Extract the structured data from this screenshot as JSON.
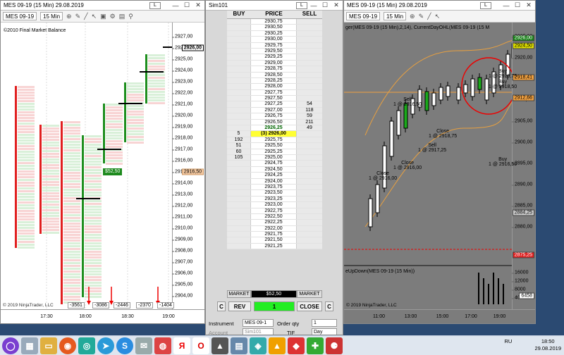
{
  "left_window": {
    "title": "MES 09-19 (15 Min) 29.08.2019",
    "title_button": "L",
    "instrument": "MES 09-19",
    "interval": "15 Min",
    "watermark": "©2010 Final Market Balance",
    "footer_copyright": "© 2019 NinjaTrader, LLC",
    "price_labels": [
      "2927,00",
      "2926,00",
      "2925,00",
      "2924,00",
      "2923,00",
      "2922,00",
      "2921,00",
      "2920,00",
      "2919,00",
      "2918,00",
      "2917,00",
      "2916,00",
      "2915,00",
      "2914,00",
      "2913,00",
      "2912,00",
      "2911,00",
      "2910,00",
      "2909,00",
      "2908,00",
      "2907,00",
      "2906,00",
      "2905,00",
      "2904,00"
    ],
    "current_price": "2926,00",
    "side_price": "2916,50",
    "pl_badge": "$52,50",
    "time_labels": [
      "17:30",
      "18:00",
      "18:30",
      "19:00"
    ],
    "delta_values": [
      "-3561",
      "-3086",
      "-2446",
      "-2370",
      "-1404"
    ],
    "colors": {
      "up": "#1e8f1e",
      "down": "#e11f1f",
      "current": "#14a814"
    }
  },
  "dom_window": {
    "title": "Sim101",
    "headers": {
      "buy": "BUY",
      "price": "PRICE",
      "sell": "SELL"
    },
    "rows": [
      {
        "buy": "",
        "price": "2930,75",
        "sell": ""
      },
      {
        "buy": "",
        "price": "2930,50",
        "sell": ""
      },
      {
        "buy": "",
        "price": "2930,25",
        "sell": ""
      },
      {
        "buy": "",
        "price": "2930,00",
        "sell": ""
      },
      {
        "buy": "",
        "price": "2929,75",
        "sell": ""
      },
      {
        "buy": "",
        "price": "2929,50",
        "sell": ""
      },
      {
        "buy": "",
        "price": "2929,25",
        "sell": ""
      },
      {
        "buy": "",
        "price": "2929,00",
        "sell": ""
      },
      {
        "buy": "",
        "price": "2928,75",
        "sell": ""
      },
      {
        "buy": "",
        "price": "2928,50",
        "sell": ""
      },
      {
        "buy": "",
        "price": "2928,25",
        "sell": ""
      },
      {
        "buy": "",
        "price": "2928,00",
        "sell": ""
      },
      {
        "buy": "",
        "price": "2927,75",
        "sell": ""
      },
      {
        "buy": "",
        "price": "2927,50",
        "sell": ""
      },
      {
        "buy": "",
        "price": "2927,25",
        "sell": "54"
      },
      {
        "buy": "",
        "price": "2927,00",
        "sell": "118"
      },
      {
        "buy": "",
        "price": "2926,75",
        "sell": "59"
      },
      {
        "buy": "",
        "price": "2926,50",
        "sell": "211"
      },
      {
        "buy": "",
        "price": "2926,25",
        "sell": "49",
        "style": "hl"
      },
      {
        "buy": "5",
        "price": "(3) 2926,00",
        "sell": "",
        "style": "cur"
      },
      {
        "buy": "192",
        "price": "2925,75",
        "sell": ""
      },
      {
        "buy": "51",
        "price": "2925,50",
        "sell": ""
      },
      {
        "buy": "60",
        "price": "2925,25",
        "sell": ""
      },
      {
        "buy": "105",
        "price": "2925,00",
        "sell": ""
      },
      {
        "buy": "",
        "price": "2924,75",
        "sell": ""
      },
      {
        "buy": "",
        "price": "2924,50",
        "sell": ""
      },
      {
        "buy": "",
        "price": "2924,25",
        "sell": ""
      },
      {
        "buy": "",
        "price": "2924,00",
        "sell": ""
      },
      {
        "buy": "",
        "price": "2923,75",
        "sell": ""
      },
      {
        "buy": "",
        "price": "2923,50",
        "sell": ""
      },
      {
        "buy": "",
        "price": "2923,25",
        "sell": ""
      },
      {
        "buy": "",
        "price": "2923,00",
        "sell": ""
      },
      {
        "buy": "",
        "price": "2922,75",
        "sell": ""
      },
      {
        "buy": "",
        "price": "2922,50",
        "sell": ""
      },
      {
        "buy": "",
        "price": "2922,25",
        "sell": ""
      },
      {
        "buy": "",
        "price": "2922,00",
        "sell": ""
      },
      {
        "buy": "",
        "price": "2921,75",
        "sell": ""
      },
      {
        "buy": "",
        "price": "2921,50",
        "sell": ""
      },
      {
        "buy": "",
        "price": "2921,25",
        "sell": ""
      }
    ],
    "market_buy": "MARKET",
    "market_sell": "MARKET",
    "pnl": "$52,50",
    "rev": "REV",
    "qty_display": "1",
    "close": "CLOSE",
    "c_left": "C",
    "c_right": "C",
    "instrument_label": "Instrument",
    "instrument_value": "MES 09-1",
    "order_qty_label": "Order qty",
    "order_qty_value": "1",
    "account_label": "Account",
    "account_value": "Sim101",
    "tif_label": "TIF",
    "tif_value": "Day"
  },
  "right_window": {
    "title": "MES 09-19 (15 Min) 29.08.2019",
    "title_button": "L",
    "instrument": "MES 09-19",
    "interval": "15 Min",
    "indicator_label": "ger(MES 09-19 (15 Min),2,14), CurrentDayOHL(MES 09-19 (15 M",
    "price_labels": [
      "2925,00",
      "2920,00",
      "2915,00",
      "2910,00",
      "2905,00",
      "2900,00",
      "2895,00",
      "2890,00",
      "2885,00",
      "2880,00"
    ],
    "badges": [
      {
        "text": "2926,00",
        "color": "#1a7f1a"
      },
      {
        "text": "2924,50",
        "color": "#e0e000"
      },
      {
        "text": "2918,41",
        "color": "#f0a040"
      },
      {
        "text": "2912,66",
        "color": "#f0a040"
      },
      {
        "text": "2884,25",
        "color": "#cccccc"
      },
      {
        "text": "2875,25",
        "color": "#dd2222"
      }
    ],
    "lower_panel_label": "eUpDown(MES 09-19 (15 Min))",
    "lower_axis_labels": [
      "16000",
      "12000",
      "8000",
      "4000"
    ],
    "lower_badge": "6458",
    "time_labels": [
      "11:00",
      "13:00",
      "15:00",
      "17:00",
      "19:00"
    ],
    "footer_copyright": "© 2019 NinjaTrader, LLC",
    "trade_annotations": [
      {
        "side": "Sell",
        "fill": "1 @ 2916,50"
      },
      {
        "side": "Close",
        "fill": "1 @ 2916,00"
      },
      {
        "side": "Close",
        "fill": "1 @ 2918,75"
      },
      {
        "side": "Buy",
        "fill": "1 @ 2918,75"
      },
      {
        "side": "Buy",
        "fill": "1 @ 2916,50"
      },
      {
        "side": "Buy",
        "fill": "1 @ 2918,50"
      },
      {
        "side": "Close",
        "fill": "1 @ 2916,00"
      },
      {
        "side": "Sell",
        "fill": "1 @ 2917,25"
      }
    ]
  },
  "taskbar": {
    "lang": "RU",
    "time": "18:50",
    "date": "29.08.2019",
    "apps": [
      "search-icon",
      "app1",
      "folder-icon",
      "firefox-icon",
      "chrome-icon",
      "telegram-icon",
      "skype-icon",
      "mail-icon",
      "chrome-icon",
      "yandex-icon",
      "opera-icon",
      "ninjatrader-icon",
      "app-icon",
      "app-icon",
      "vlc-icon",
      "app-icon",
      "app-icon",
      "app-icon"
    ]
  }
}
